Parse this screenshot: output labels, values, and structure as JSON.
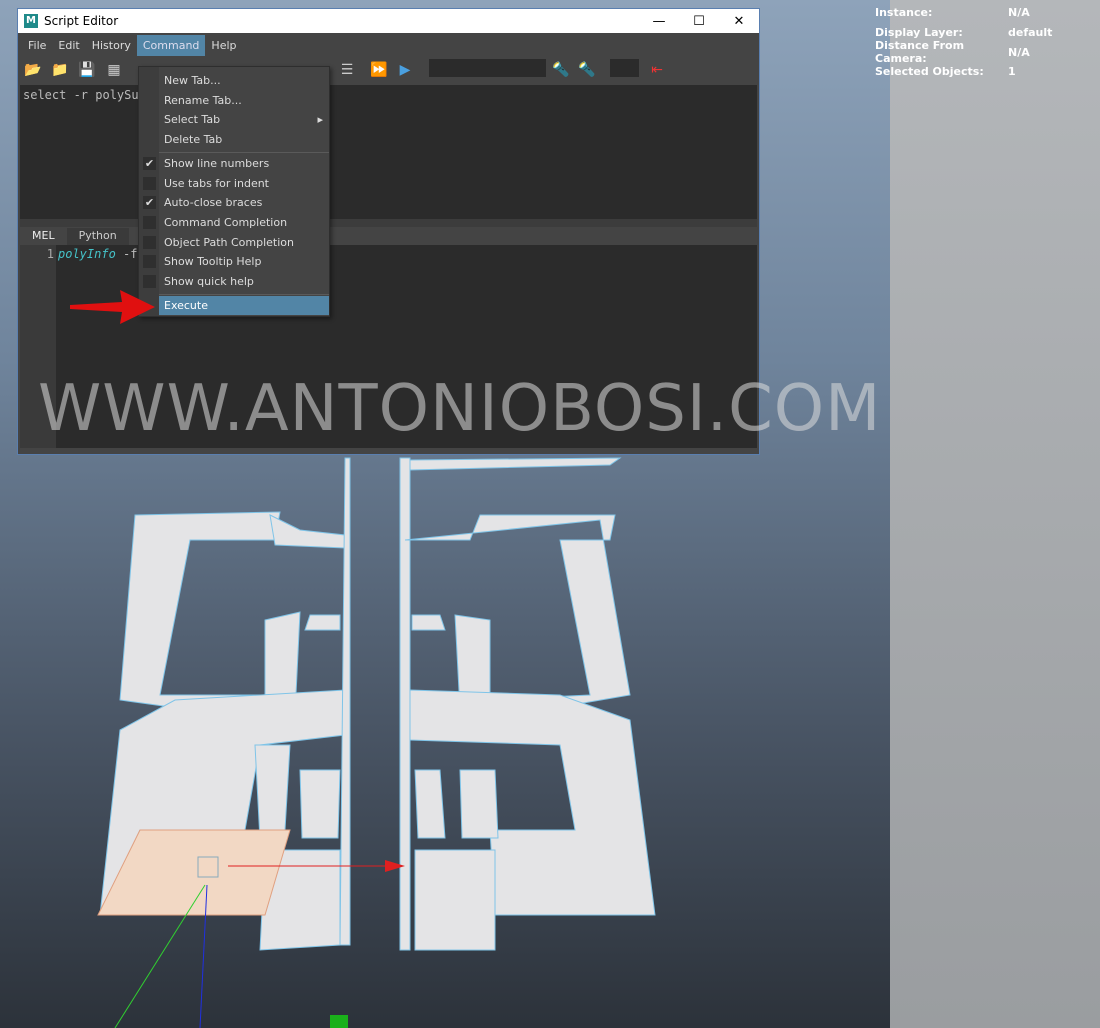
{
  "window": {
    "title": "Script Editor",
    "minimize": "—",
    "maximize": "☐",
    "close": "✕"
  },
  "menubar": [
    "File",
    "Edit",
    "History",
    "Command",
    "Help"
  ],
  "top_editor": {
    "text": "select -r polySu"
  },
  "tabs": [
    "MEL",
    "Python"
  ],
  "bottom_editor": {
    "line": "1",
    "keyword": "polyInfo",
    "rest": " -f"
  },
  "command_menu": {
    "items": [
      {
        "label": "New Tab...",
        "checked": null
      },
      {
        "label": "Rename Tab...",
        "checked": null
      },
      {
        "label": "Select Tab",
        "checked": null,
        "submenu": "▸"
      },
      {
        "label": "Delete Tab",
        "checked": null
      },
      {
        "label": "Show line numbers",
        "checked": true
      },
      {
        "label": "Use tabs for indent",
        "checked": false
      },
      {
        "label": "Auto-close braces",
        "checked": true
      },
      {
        "label": "Command Completion",
        "checked": false
      },
      {
        "label": "Object Path Completion",
        "checked": false
      },
      {
        "label": "Show Tooltip Help",
        "checked": false
      },
      {
        "label": "Show quick help",
        "checked": false
      },
      {
        "label": "Execute",
        "checked": null,
        "highlighted": true
      }
    ]
  },
  "hud": [
    {
      "key": "Instance:",
      "value": "N/A"
    },
    {
      "key": "Display Layer:",
      "value": "default"
    },
    {
      "key": "Distance From Camera:",
      "value": "N/A"
    },
    {
      "key": "Selected Objects:",
      "value": "1"
    }
  ],
  "watermark": "WWW.ANTONIOBOSI.COM",
  "colors": {
    "menu_highlight": "#5285a6",
    "mel_keyword": "#45c2c8",
    "arrow": "#e01010"
  }
}
